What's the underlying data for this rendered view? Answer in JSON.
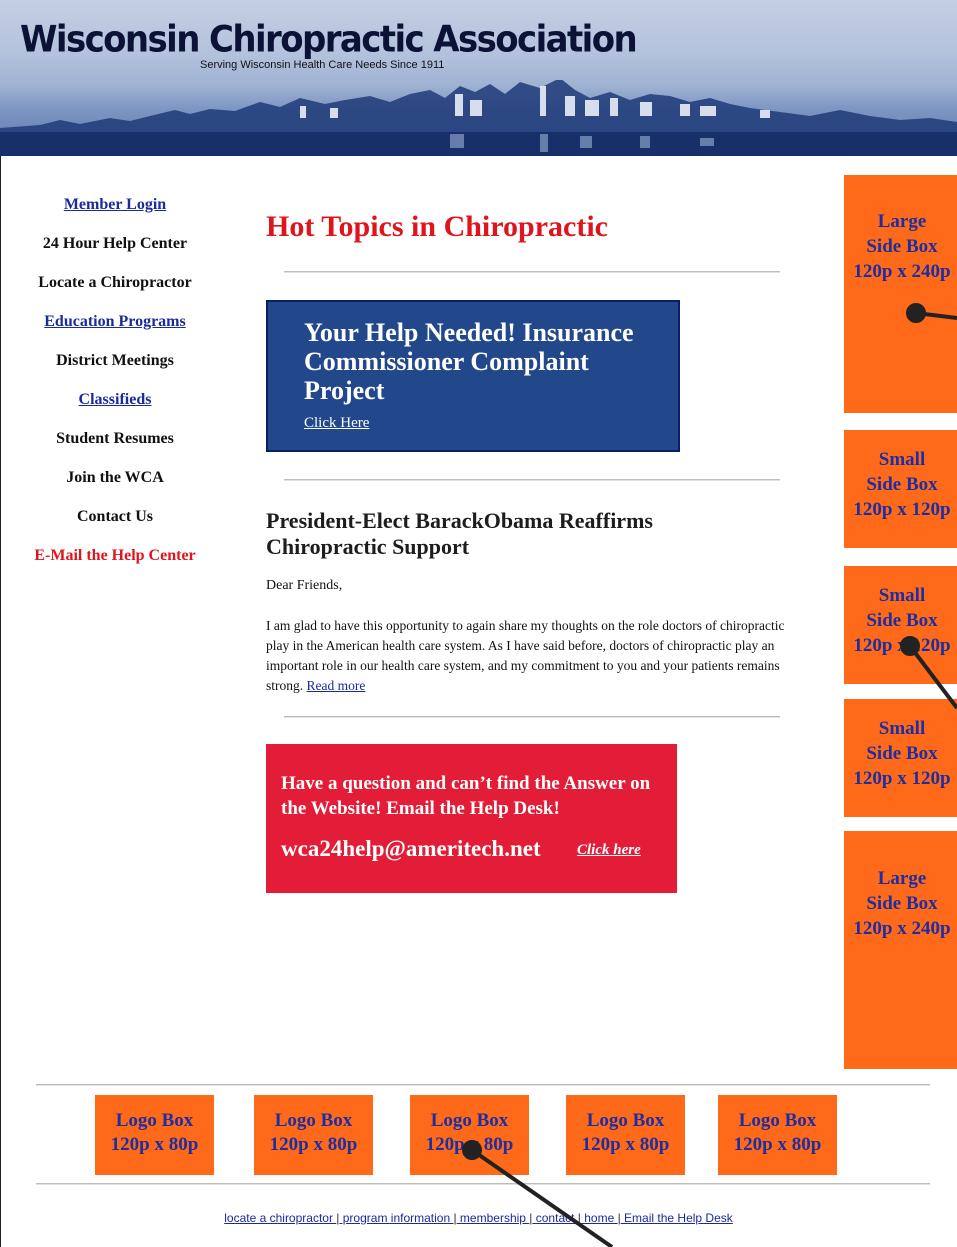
{
  "header": {
    "title": "Wisconsin Chiropractic Association",
    "subtitle": "Serving Wisconsin Health Care Needs Since 1911"
  },
  "nav": {
    "items": [
      {
        "label": "Member Login",
        "style": "link"
      },
      {
        "label": "24 Hour Help Center",
        "style": "plain"
      },
      {
        "label": "Locate a Chiropractor",
        "style": "plain"
      },
      {
        "label": "Education Programs",
        "style": "link"
      },
      {
        "label": "District Meetings",
        "style": "plain"
      },
      {
        "label": "Classifieds",
        "style": "link"
      },
      {
        "label": "Student Resumes",
        "style": "plain"
      },
      {
        "label": "Join the WCA",
        "style": "plain"
      },
      {
        "label": "Contact Us",
        "style": "plain"
      },
      {
        "label": "E-Mail the Help Center",
        "style": "red"
      }
    ]
  },
  "main": {
    "title": "Hot Topics in Chiropractic",
    "help_box": {
      "heading": "Your Help Needed! Insurance Commissioner Complaint Project",
      "link": "Click Here"
    },
    "article": {
      "title": "President-Elect BarackObama Reaffirms Chiropractic Support",
      "greeting": "Dear Friends,",
      "body": "I am glad to have this opportunity to again share my thoughts on the role doctors of chiropractic play in the American health care system. As I have said before, doctors of chiropractic play an important role in our health care system, and my commitment to you and your patients remains strong.",
      "read_more": "Read more"
    },
    "question_box": {
      "text": "Have a question and can’t find the Answer on the Website! Email the Help Desk!",
      "email": "wca24help@ameritech.net",
      "click": "Click here"
    }
  },
  "side_boxes": [
    {
      "l1": "Large",
      "l2": "Side Box",
      "l3": "120p x 240p"
    },
    {
      "l1": "Small",
      "l2": "Side Box",
      "l3": "120p x 120p"
    },
    {
      "l1": "Small",
      "l2": "Side Box",
      "l3": "120p x 120p"
    },
    {
      "l1": "Small",
      "l2": "Side Box",
      "l3": "120p x 120p"
    },
    {
      "l1": "Large",
      "l2": "Side Box",
      "l3": "120p x 240p"
    }
  ],
  "logo_boxes": [
    {
      "l1": "Logo Box",
      "l2": "120p x 80p"
    },
    {
      "l1": "Logo Box",
      "l2": "120p x 80p"
    },
    {
      "l1": "Logo Box",
      "l2": "120p x 80p"
    },
    {
      "l1": "Logo Box",
      "l2": "120p x 80p"
    },
    {
      "l1": "Logo Box",
      "l2": "120p x 80p"
    }
  ],
  "footer": {
    "links": [
      "locate a chiropractor ",
      " program information ",
      " membership ",
      " contact ",
      " home ",
      " Email the Help Desk"
    ],
    "separator": "|"
  },
  "colors": {
    "orange": "#ff6a1a",
    "navy_box": "#22488b",
    "red_box": "#e31d37",
    "title_red": "#e0141c",
    "link_blue": "#1a2b9a"
  }
}
